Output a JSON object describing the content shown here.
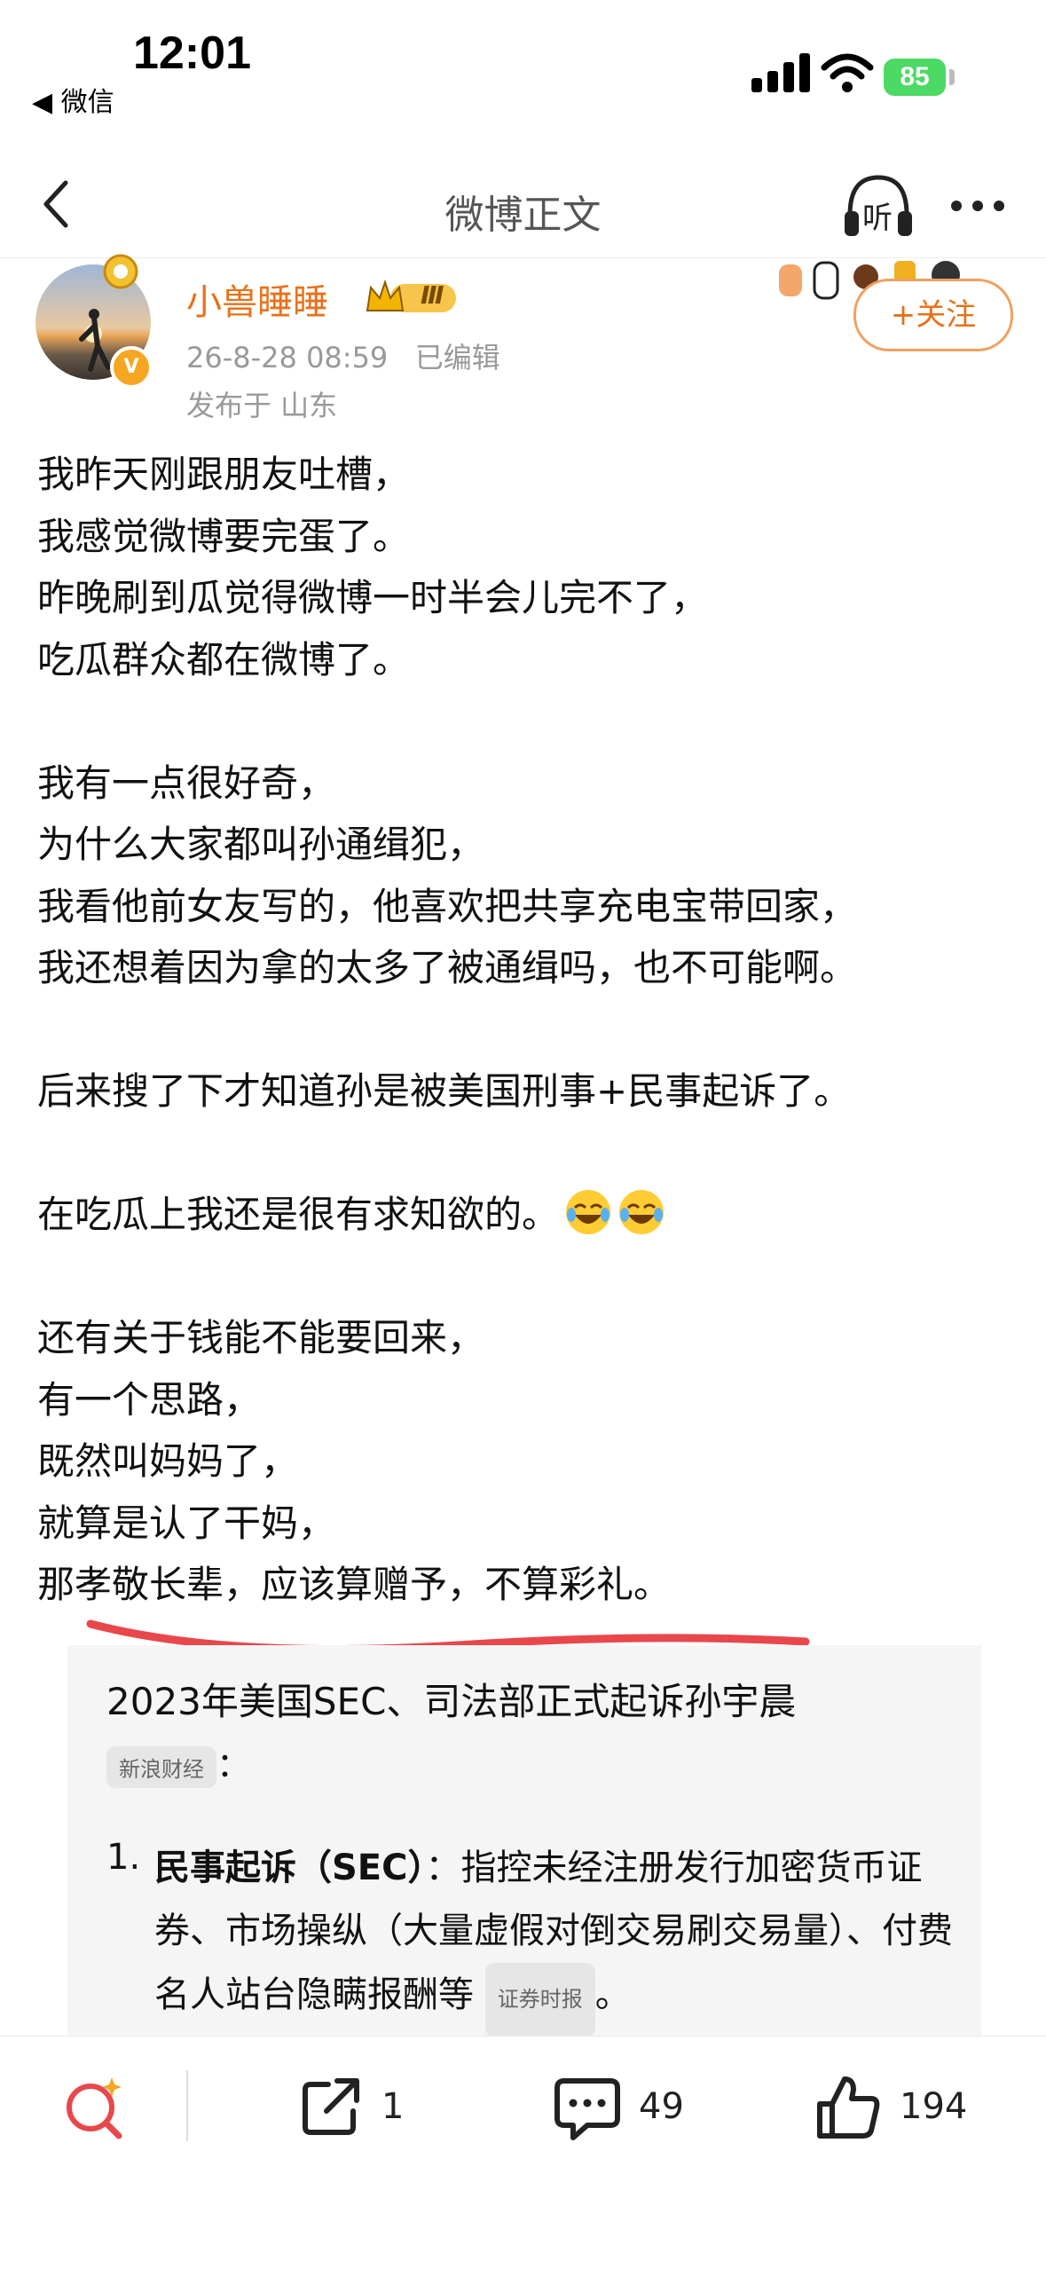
{
  "status_bar": {
    "time": "12:01",
    "back_app": "◀ 微信",
    "battery": "85"
  },
  "nav": {
    "title": "微博正文",
    "listen_label": "听"
  },
  "post": {
    "username": "小兽睡睡",
    "level_badge": "Ⅲ",
    "verified_badge": "V",
    "meta": "26-8-28 08:59   已编辑",
    "location": "发布于 山东",
    "follow_label": "+关注",
    "lines": [
      "我昨天刚跟朋友吐槽，",
      "我感觉微博要完蛋了。",
      "昨晚刷到瓜觉得微博一时半会儿完不了，",
      "吃瓜群众都在微博了。",
      "",
      "我有一点很好奇，",
      "为什么大家都叫孙通缉犯，",
      "我看他前女友写的，他喜欢把共享充电宝带回家，",
      "我还想着因为拿的太多了被通缉吗，也不可能啊。",
      "",
      "后来搜了下才知道孙是被美国刑事+民事起诉了。",
      "",
      "在吃瓜上我还是很有求知欲的。",
      "",
      "还有关于钱能不能要回来，",
      "有一个思路，",
      "既然叫妈妈了，",
      "就算是认了干妈，",
      "那孝敬长辈，应该算赠予，不算彩礼。"
    ]
  },
  "ai_card": {
    "title": "2023年美国SEC、司法部正式起诉孙宇晨",
    "source1": "新浪财经",
    "source1_suffix": "：",
    "item1_num": "1.",
    "item1_bold": "民事起诉（SEC）",
    "item1_text": "：指控未经注册发行加密货币证券、市场操纵（大量虚假对倒交易刷交易量）、付费名人站台隐瞒报酬等",
    "source2": "证券时报",
    "item1_end": "。"
  },
  "bottom_bar": {
    "repost_count": "1",
    "comment_count": "49",
    "like_count": "194"
  },
  "colors": {
    "accent_orange": "#e8711a",
    "underline_red": "#e8474c"
  }
}
